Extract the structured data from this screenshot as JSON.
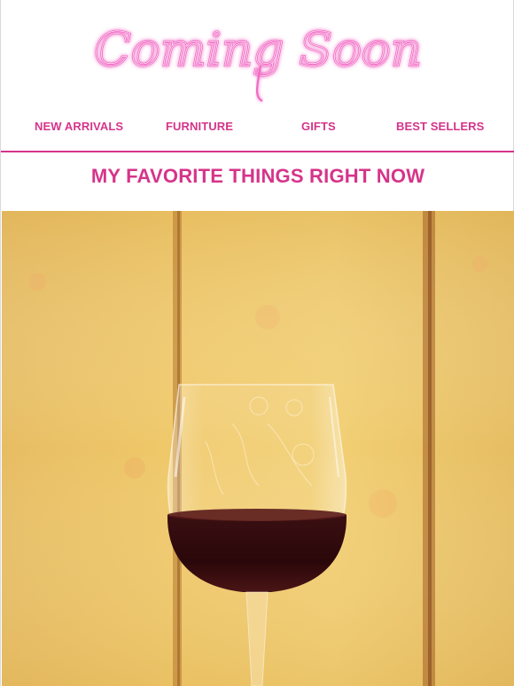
{
  "brand": {
    "logo_text": "Coming Soon",
    "logo_color": "#f06bc4"
  },
  "nav": {
    "items": [
      {
        "label": "NEW ARRIVALS"
      },
      {
        "label": "FURNITURE"
      },
      {
        "label": "GIFTS"
      },
      {
        "label": "BEST SELLERS"
      }
    ]
  },
  "section": {
    "headline": "MY FAVORITE THINGS RIGHT NOW"
  },
  "hero": {
    "image_subject": "wine-glass-photo"
  },
  "colors": {
    "accent": "#d6348a",
    "background": "#ffffff"
  }
}
